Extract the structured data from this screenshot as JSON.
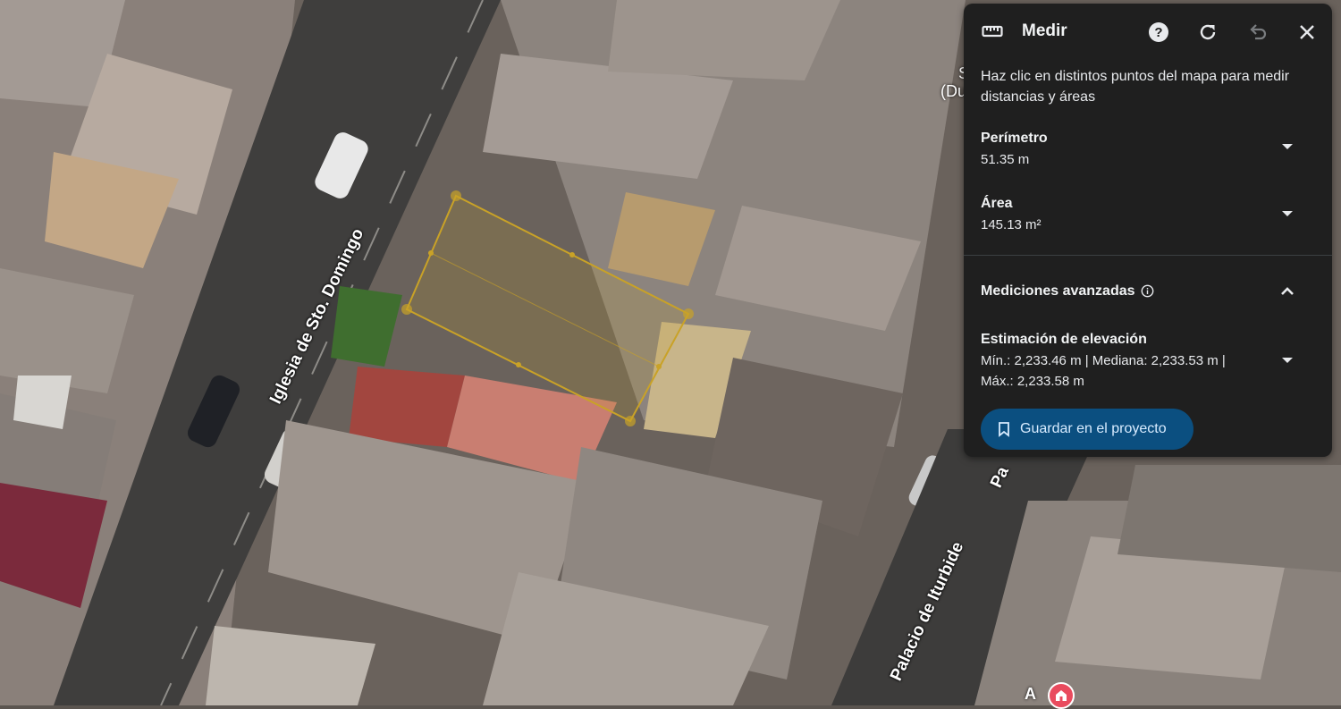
{
  "map": {
    "road_labels": [
      "Iglesia de Sto. Domingo",
      "Palacio de Iturbide",
      "Pa"
    ],
    "partial_labels": [
      "S",
      "(Du"
    ],
    "marker_letter": "A",
    "measure_color": "#c9a227"
  },
  "panel": {
    "title": "Medir",
    "icons": [
      "ruler-icon",
      "help-icon",
      "refresh-icon",
      "undo-icon",
      "close-icon"
    ],
    "description": "Haz clic en distintos puntos del mapa para medir distancias y áreas",
    "perimeter": {
      "label": "Perímetro",
      "value": "51.35 m"
    },
    "area": {
      "label": "Área",
      "value": "145.13 m²"
    },
    "advanced": {
      "label": "Mediciones avanzadas"
    },
    "elevation": {
      "label": "Estimación de elevación",
      "line1": "Mín.: 2,233.46 m | Mediana: 2,233.53 m |",
      "line2": "Máx.: 2,233.58 m"
    },
    "save_button": "Guardar en el proyecto",
    "accent": "#0b4f80"
  }
}
